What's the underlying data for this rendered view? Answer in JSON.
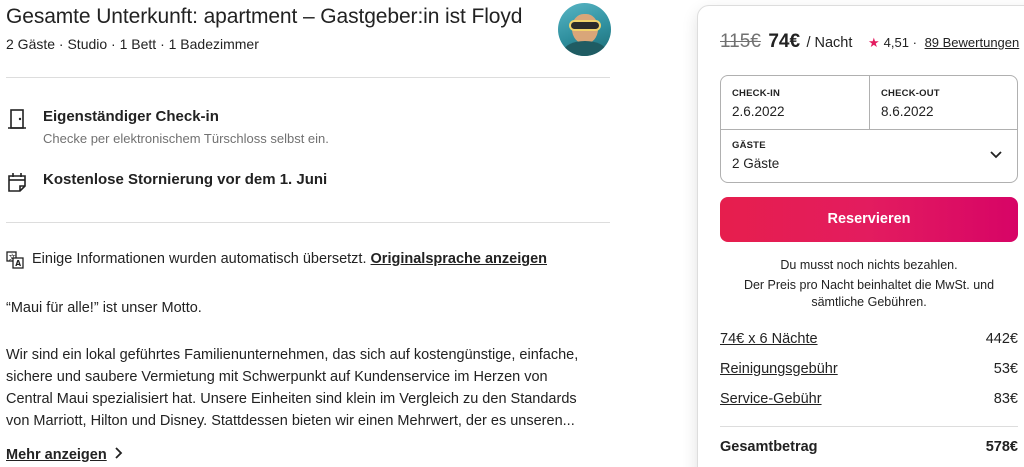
{
  "listing": {
    "title": "Gesamte Unterkunft: apartment – Gastgeber:in ist Floyd",
    "subtitle": "2 Gäste · Studio · 1 Bett · 1 Badezimmer"
  },
  "features": [
    {
      "icon": "door-icon",
      "title": "Eigenständiger Check-in",
      "description": "Checke per elektronischem Türschloss selbst ein."
    },
    {
      "icon": "calendar-icon",
      "title": "Kostenlose Stornierung vor dem 1. Juni",
      "description": ""
    }
  ],
  "translation": {
    "text": "Einige Informationen wurden automatisch übersetzt.",
    "link": "Originalsprache anzeigen"
  },
  "description": {
    "motto": "“Maui für alle!” ist unser Motto.",
    "lines": [
      "Wir sind ein lokal geführtes Familienunternehmen, das sich auf kostengünstige, einfache,",
      "sichere und saubere Vermietung mit Schwerpunkt auf Kundenservice im Herzen von",
      "Central Maui spezialisiert hat. Unsere Einheiten sind klein im Vergleich zu den Standards",
      "von Marriott, Hilton und Disney. Stattdessen bieten wir einen Mehrwert, der es unseren..."
    ],
    "more_label": "Mehr anzeigen"
  },
  "booking_card": {
    "old_price": "115€",
    "new_price": "74€",
    "per_night": "/ Nacht",
    "rating": "4,51",
    "separator": "·",
    "reviews": "89 Bewertungen",
    "checkin_label": "CHECK-IN",
    "checkin_value": "2.6.2022",
    "checkout_label": "CHECK-OUT",
    "checkout_value": "8.6.2022",
    "guests_label": "GÄSTE",
    "guests_value": "2 Gäste",
    "reserve_label": "Reservieren",
    "note_no_charge": "Du musst noch nichts bezahlen.",
    "note_tax": "Der Preis pro Nacht beinhaltet die MwSt. und sämtliche Gebühren.",
    "fees": [
      {
        "label": "74€ x 6 Nächte",
        "amount": "442€"
      },
      {
        "label": "Reinigungsgebühr",
        "amount": "53€"
      },
      {
        "label": "Service-Gebühr",
        "amount": "83€"
      }
    ],
    "total_label": "Gesamtbetrag",
    "total_amount": "578€"
  },
  "colors": {
    "accent": "#e31c5f",
    "text": "#222222",
    "muted": "#717171",
    "border": "#dddddd"
  }
}
